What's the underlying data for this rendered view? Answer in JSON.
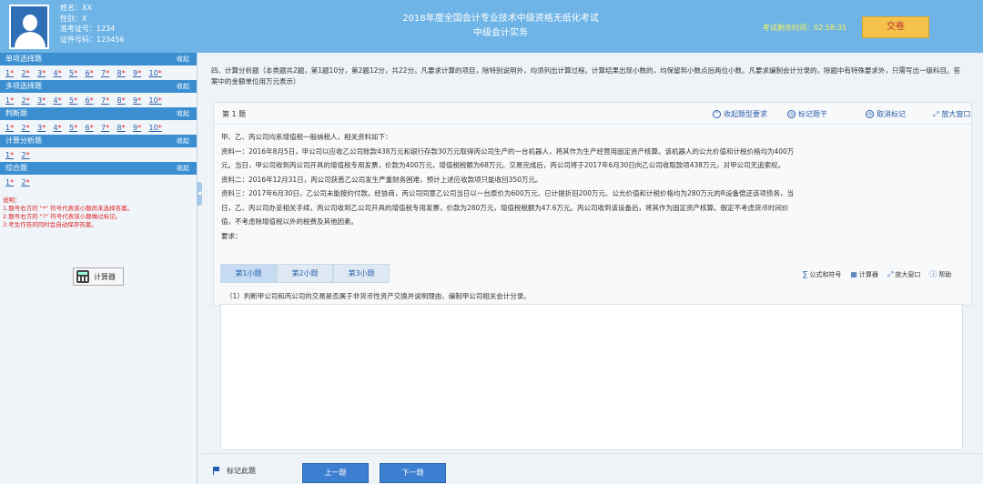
{
  "candidate": {
    "name": "姓名：XX",
    "gender": "性别：X",
    "ticket": "准考证号：1234",
    "id": "证件号码：123456"
  },
  "exam": {
    "title": "2018年度全国会计专业技术中级资格无纸化考试",
    "subject": "中级会计实务"
  },
  "timer": {
    "text": "考试剩余时间：02:58:35"
  },
  "submit_label": "交卷",
  "sidebar": {
    "collapse_label": "收起",
    "sections": [
      {
        "title": "单项选择题",
        "count": 10
      },
      {
        "title": "多项选择题",
        "count": 10
      },
      {
        "title": "判断题",
        "count": 10
      },
      {
        "title": "计算分析题",
        "count": 2
      },
      {
        "title": "综合题",
        "count": 2
      }
    ],
    "notes": [
      "说明：",
      "1.题号右方的 \"*\" 符号代表该小题尚未选择答案。",
      "2.题号右方的 \"?\" 符号代表该小题做过标记。",
      "3.考生作答的同时会自动保存答案。"
    ],
    "calc_label": "计算器"
  },
  "main": {
    "intro": "四、计算分析题（本类题共2题，第1题10分，第2题12分，共22分。凡要求计算的项目，除特别说明外，均须列出计算过程。计算结果出现小数的，均保留到小数点后两位小数。凡要求编制会计分录的，除题中有特殊要求外，只需写出一级科目。答案中的金额单位用万元表示）",
    "question_title": "第 1 题",
    "tools": {
      "collapse": "收起题型要求",
      "mark": "标记题干",
      "unmark": "取消标记",
      "enlarge": "放大窗口"
    },
    "question_lines": [
      "甲、乙、丙公司均系增值税一般纳税人，相关资料如下：",
      "资料一：2016年8月5日，甲公司以应收乙公司账款438万元和银行存款30万元取得丙公司生产的一台机器人，将其作为生产经营用固定资产核算。该机器人的公允价值和计税价格均为400万",
      "元。当日，甲公司收到丙公司开具的增值税专用发票，价款为400万元，增值税税额为68万元。交易完成后，丙公司将于2017年6月30日向乙公司收取款项438万元，对甲公司无追索权。",
      "资料二：2016年12月31日，丙公司获悉乙公司发生严重财务困难，预计上述应收款项只能收回350万元。",
      "资料三：2017年6月30日，乙公司未能按约付款。经协商，丙公司同意乙公司当日以一台原价为600万元、已计提折旧200万元、公允价值和计税价格均为280万元的R设备偿还该项债务，当",
      "日，乙、丙公司办妥相关手续，丙公司收到乙公司开具的增值税专用发票，价款为280万元，增值税税额为47.6万元。丙公司收到该设备后，将其作为固定资产核算。假定不考虑货币时间价",
      "值，不考虑除增值税以外的税费及其他因素。",
      "要求："
    ],
    "subtabs": [
      "第1小题",
      "第2小题",
      "第3小题"
    ],
    "answer_tools": {
      "formula": "公式和符号",
      "calc": "计算器",
      "enlarge": "放大窗口",
      "help": "帮助"
    },
    "sub_question": "（1）判断甲公司和丙公司的交易是否属于非货币性资产交换并说明理由，编制甲公司相关会计分录。",
    "answer_value": ""
  },
  "footer": {
    "mark_label": "标记此题",
    "prev_label": "上一题",
    "next_label": "下一题"
  }
}
